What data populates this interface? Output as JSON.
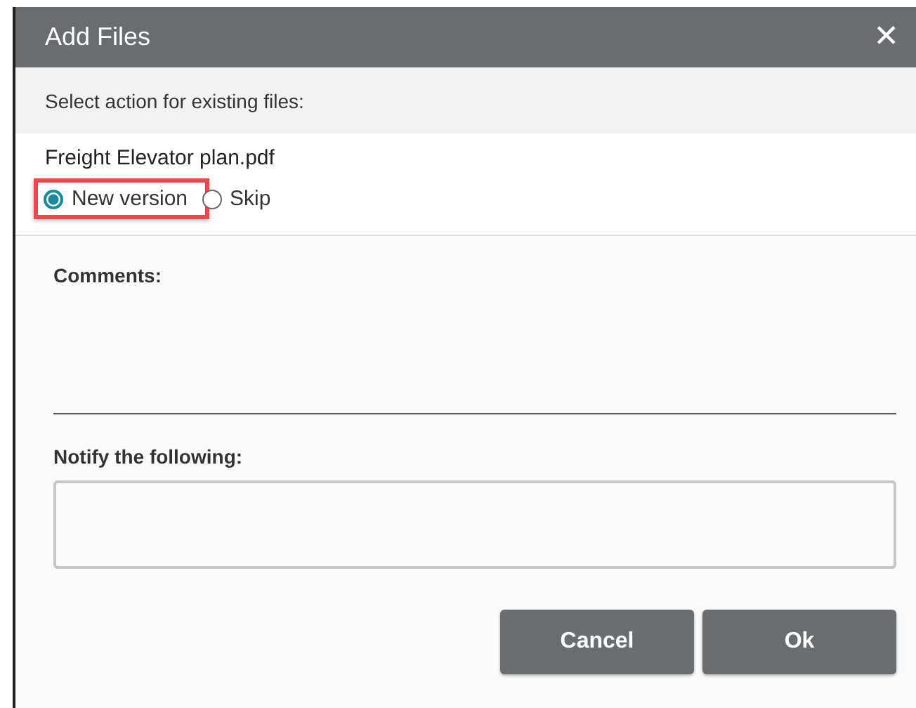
{
  "window": {
    "title": "Add Files",
    "close": "✕"
  },
  "instruction": "Select action for existing files:",
  "file": {
    "name": "Freight Elevator plan.pdf",
    "options": [
      {
        "label": "New version",
        "selected": true
      },
      {
        "label": "Skip",
        "selected": false
      }
    ]
  },
  "comments": {
    "label": "Comments:"
  },
  "notify": {
    "label": "Notify the following:"
  },
  "buttons": [
    "Cancel",
    "Ok"
  ]
}
